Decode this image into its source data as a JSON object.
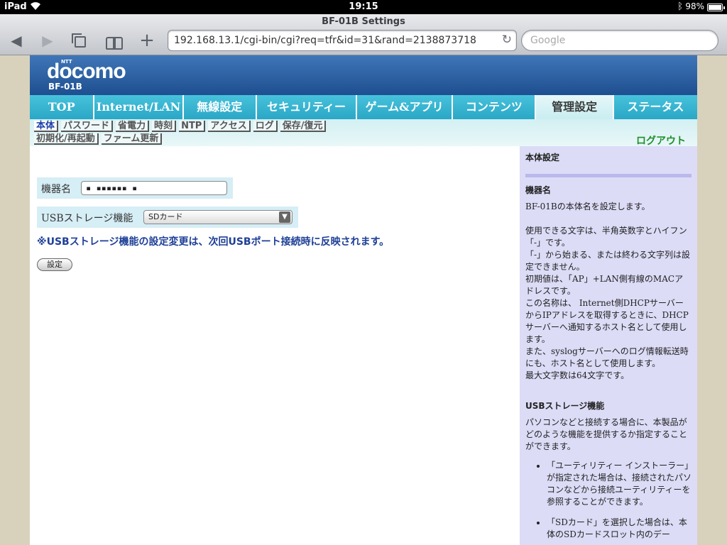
{
  "status_bar": {
    "carrier": "iPad",
    "time": "19:15",
    "battery": "98%",
    "battery_level": 0.98
  },
  "browser": {
    "page_title": "BF-01B Settings",
    "url": "192.168.13.1/cgi-bin/cgi?req=tfr&id=31&rand=2138873718",
    "search_placeholder": "Google"
  },
  "header": {
    "ntt": "NTT",
    "logo": "docomo",
    "model": "BF-01B"
  },
  "main_nav": [
    {
      "label": "TOP",
      "active": false
    },
    {
      "label": "Internet/LAN",
      "active": false
    },
    {
      "label": "無線設定",
      "active": false
    },
    {
      "label": "セキュリティー",
      "active": false
    },
    {
      "label": "ゲーム&アプリ",
      "active": false
    },
    {
      "label": "コンテンツ",
      "active": false
    },
    {
      "label": "管理設定",
      "active": true
    },
    {
      "label": "ステータス",
      "active": false
    }
  ],
  "sub_nav": {
    "row1": [
      {
        "label": "本体",
        "active": true
      },
      {
        "label": "パスワード",
        "active": false
      },
      {
        "label": "省電力",
        "active": false
      },
      {
        "label": "時刻",
        "active": false
      },
      {
        "label": "NTP",
        "active": false
      },
      {
        "label": "アクセス",
        "active": false
      },
      {
        "label": "ログ",
        "active": false
      },
      {
        "label": "保存/復元",
        "active": false
      }
    ],
    "row2": [
      {
        "label": "初期化/再起動",
        "active": false
      },
      {
        "label": "ファーム更新",
        "active": false
      }
    ],
    "logout": "ログアウト"
  },
  "form": {
    "device_name_label": "機器名",
    "device_name_value": "▪ ▪▪▪▪▪▪ ▪",
    "usb_label": "USBストレージ機能",
    "usb_value": "SDカード",
    "notice": "※USBストレージ機能の設定変更は、次回USBポート接続時に反映されます。",
    "submit": "設定"
  },
  "help": {
    "title": "本体設定",
    "name_heading": "機器名",
    "name_p1": "BF-01Bの本体名を設定します。",
    "name_p2": "使用できる文字は、半角英数字とハイフン「-」です。",
    "name_p3": "「-」から始まる、または終わる文字列は設定できません。",
    "name_p4": "初期値は、「AP」+LAN側有線のMACアドレスです。",
    "name_p5": "この名称は、 Internet側DHCPサーバーからIPアドレスを取得するときに、DHCPサーバーへ通知するホスト名として使用します。",
    "name_p6": "また、syslogサーバーへのログ情報転送時にも、ホスト名として使用します。",
    "name_p7": "最大文字数は64文字です。",
    "usb_heading": "USBストレージ機能",
    "usb_p1": "パソコンなどと接続する場合に、本製品がどのような機能を提供するか指定することができます。",
    "usb_bullets": [
      "「ユーティリティー インストーラー」が指定された場合は、接続されたパソコンなどから接続ユーティリティーを参照することができます。",
      "「SDカード」を選択した場合は、本体のSDカードスロット内のデー"
    ]
  }
}
